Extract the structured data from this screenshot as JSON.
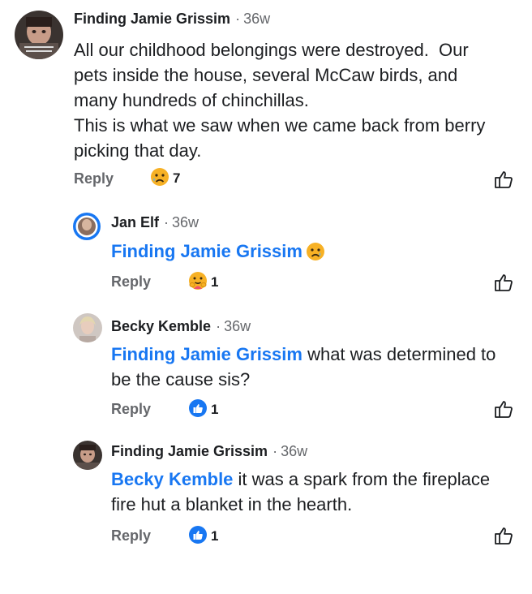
{
  "comments": [
    {
      "author": "Finding Jamie Grissim",
      "time": "36w",
      "text_lines": [
        "All our childhood belongings were destroyed.  Our",
        "pets inside the house, several McCaw birds, and",
        "many hundreds of chinchillas.",
        "This is what we saw when we came back from berry",
        "picking that day."
      ],
      "reply_label": "Reply",
      "reaction": "sad-face-icon",
      "reaction_count": "7"
    },
    {
      "author": "Jan Elf",
      "time": "36w",
      "mention": "Finding Jamie Grissim",
      "reply_label": "Reply",
      "reaction": "care-face-icon",
      "reaction_count": "1"
    },
    {
      "author": "Becky Kemble",
      "time": "36w",
      "mention": "Finding Jamie Grissim",
      "text_line1": " what was determined to",
      "text_line2": "be the cause sis?",
      "reply_label": "Reply",
      "reaction": "like-icon",
      "reaction_count": "1"
    },
    {
      "author": "Finding Jamie Grissim",
      "time": "36w",
      "mention": "Becky Kemble",
      "text_line1": " it was a spark from the fireplace",
      "text_line2": "fire hut a blanket in the hearth.",
      "reply_label": "Reply",
      "reaction": "like-icon",
      "reaction_count": "1"
    }
  ],
  "dot": "·",
  "colors": {
    "mention": "#1877f2",
    "secondary": "#65676b",
    "like_blue": "#1877f2"
  }
}
